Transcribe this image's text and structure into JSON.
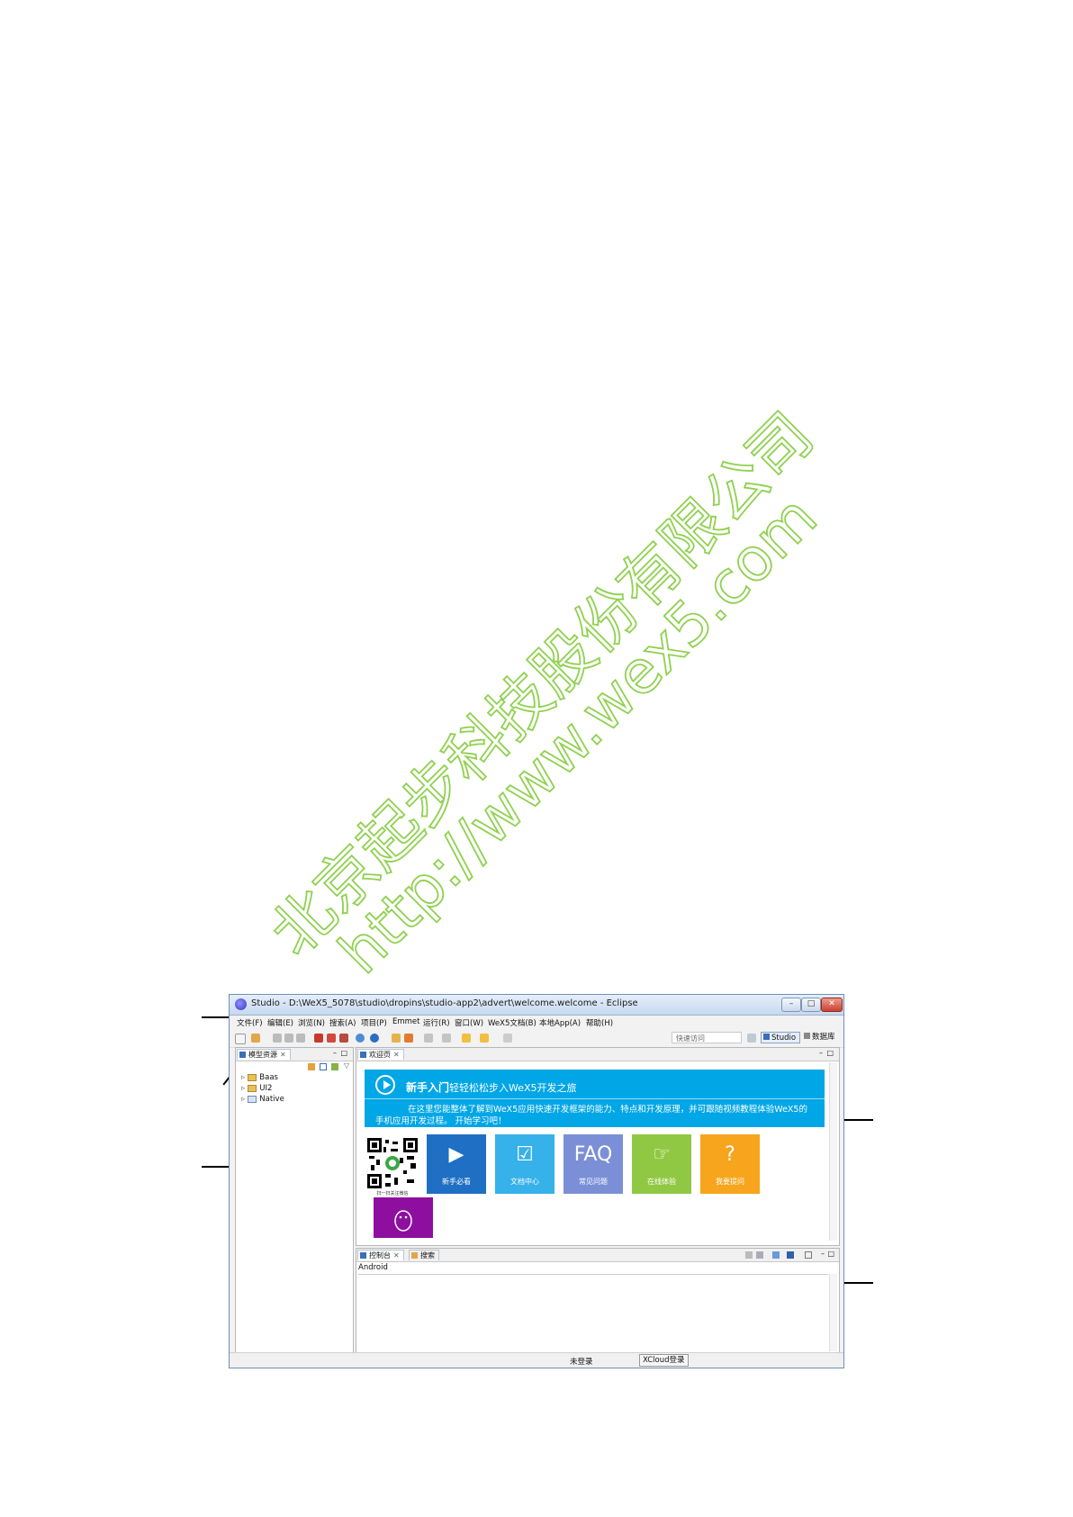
{
  "watermark": {
    "line1": "北京起步科技股份有限公司",
    "line2": "http://www.wex5.com",
    "color": "#8fd14f"
  },
  "window": {
    "title": "Studio - D:\\WeX5_5078\\studio\\dropins\\studio-app2\\advert\\welcome.welcome - Eclipse",
    "minimize": "–",
    "maximize": "□",
    "close": "✕"
  },
  "menu": [
    "文件(F)",
    "编辑(E)",
    "浏览(N)",
    "搜索(A)",
    "项目(P)",
    "Emmet",
    "运行(R)",
    "窗口(W)",
    "WeX5文档(B)",
    "本地App(A)",
    "帮助(H)"
  ],
  "toolbar": {
    "quick_access": "快速访问",
    "perspective_studio": "Studio",
    "perspective_db": "数据库"
  },
  "left_panel": {
    "tab": "模型资源",
    "tree": [
      {
        "label": "Baas"
      },
      {
        "label": "UI2"
      },
      {
        "label": "Native"
      }
    ]
  },
  "editor": {
    "tab": "欢迎页",
    "banner": {
      "title": "新手入门",
      "subtitle": "轻轻松松步入WeX5开发之旅",
      "description": "在这里您能整体了解到WeX5应用快速开发框架的能力、特点和开发原理，并可跟随视频教程体验WeX5的手机应用开发过程。  开始学习吧！",
      "color": "#00a6e6"
    },
    "qr_caption": "扫一扫关注微信",
    "tiles": [
      {
        "label": "新手必看",
        "glyph": "▶",
        "color": "#1f6fc4"
      },
      {
        "label": "文档中心",
        "glyph": "☑",
        "color": "#36b1ea"
      },
      {
        "label": "常见问题",
        "glyph": "FAQ",
        "color": "#7a8fd6"
      },
      {
        "label": "在线体验",
        "glyph": "☞",
        "color": "#90c843"
      },
      {
        "label": "我要提问",
        "glyph": "?",
        "color": "#f7a51c"
      }
    ],
    "qq_tile_color": "#8e0f9f"
  },
  "console": {
    "tabs": [
      "控制台",
      "搜索"
    ],
    "line": "Android"
  },
  "status": {
    "login": "未登录",
    "xcloud": "XCloud登录"
  }
}
